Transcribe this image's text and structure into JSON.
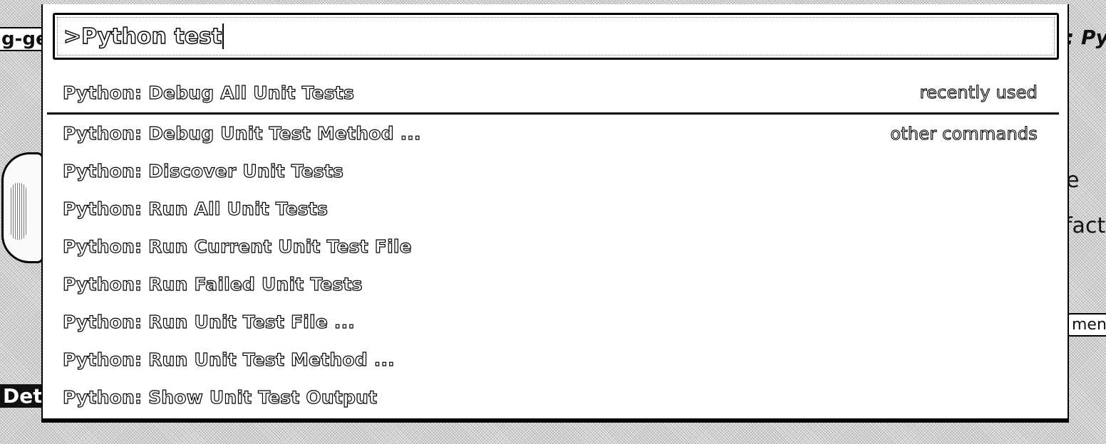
{
  "background": {
    "left_top_text": "g-ge",
    "right_top_text": ": Py",
    "right_mid_text": "e",
    "right_fact_text": "fact",
    "right_menu_text": "menc",
    "left_bottom_text": "Det"
  },
  "palette": {
    "input_value": ">Python test",
    "results": [
      {
        "label": "Python: Debug All Unit Tests",
        "group": "recently used"
      },
      {
        "label": "Python: Debug Unit Test Method ...",
        "group": "other commands"
      },
      {
        "label": "Python: Discover Unit Tests",
        "group": ""
      },
      {
        "label": "Python: Run All Unit Tests",
        "group": ""
      },
      {
        "label": "Python: Run Current Unit Test File",
        "group": ""
      },
      {
        "label": "Python: Run Failed Unit Tests",
        "group": ""
      },
      {
        "label": "Python: Run Unit Test File ...",
        "group": ""
      },
      {
        "label": "Python: Run Unit Test Method ...",
        "group": ""
      },
      {
        "label": "Python: Show Unit Test Output",
        "group": ""
      }
    ]
  }
}
